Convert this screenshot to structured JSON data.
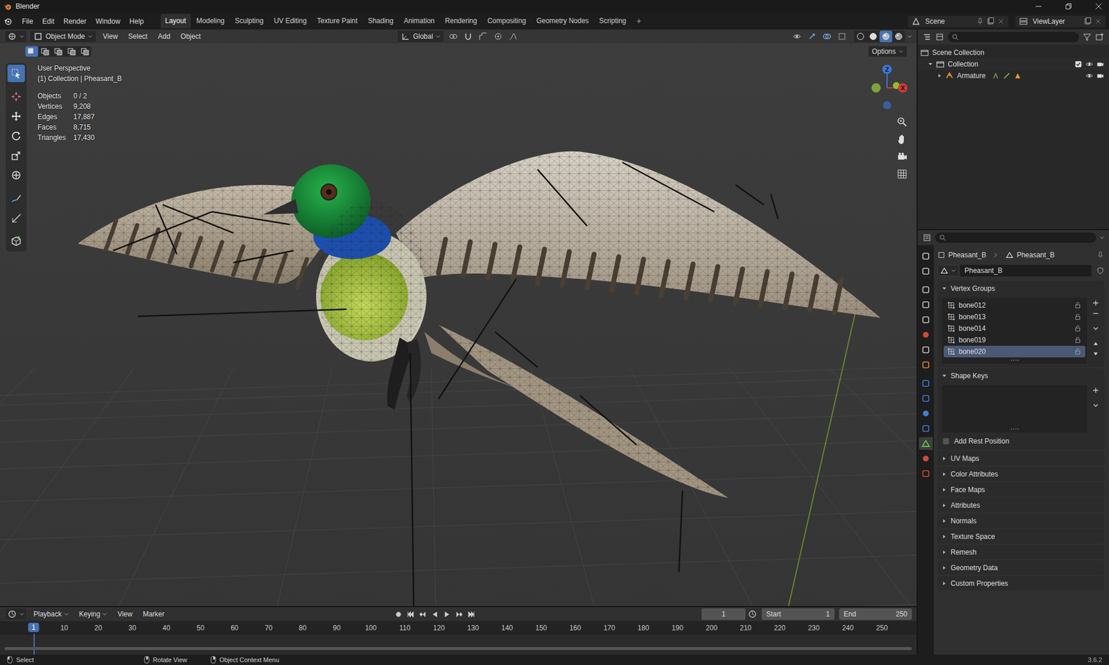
{
  "window": {
    "title": "Blender"
  },
  "menus": [
    "File",
    "Edit",
    "Render",
    "Window",
    "Help"
  ],
  "workspaces": [
    {
      "label": "Layout",
      "selected": true
    },
    {
      "label": "Modeling",
      "selected": false
    },
    {
      "label": "Sculpting",
      "selected": false
    },
    {
      "label": "UV Editing",
      "selected": false
    },
    {
      "label": "Texture Paint",
      "selected": false
    },
    {
      "label": "Shading",
      "selected": false
    },
    {
      "label": "Animation",
      "selected": false
    },
    {
      "label": "Rendering",
      "selected": false
    },
    {
      "label": "Compositing",
      "selected": false
    },
    {
      "label": "Geometry Nodes",
      "selected": false
    },
    {
      "label": "Scripting",
      "selected": false
    }
  ],
  "add_workspace": "+",
  "scene": "Scene",
  "view_layer": "ViewLayer",
  "viewport": {
    "mode": "Object Mode",
    "menus": [
      "View",
      "Select",
      "Add",
      "Object"
    ],
    "orientation": "Global",
    "options": "Options",
    "select_modes": [
      {
        "selected": true
      },
      {
        "selected": false
      },
      {
        "selected": false
      },
      {
        "selected": false
      },
      {
        "selected": false
      }
    ],
    "shading_modes": [
      {
        "selected": false
      },
      {
        "selected": false
      },
      {
        "selected": true
      },
      {
        "selected": false
      }
    ],
    "tools": [
      {
        "kind": "select",
        "selected": true
      },
      {
        "kind": "cursor",
        "selected": false
      },
      {
        "kind": "move",
        "selected": false
      },
      {
        "kind": "rotate",
        "selected": false
      },
      {
        "kind": "scale",
        "selected": false
      },
      {
        "kind": "transform",
        "selected": false
      },
      {
        "kind": "annotate",
        "selected": false
      },
      {
        "kind": "measure",
        "selected": false
      },
      {
        "kind": "add",
        "selected": false
      }
    ],
    "overlay": {
      "title": "User Perspective",
      "subtitle": "(1) Collection | Pheasant_B",
      "stats": [
        {
          "label": "Objects",
          "value": "0 / 2"
        },
        {
          "label": "Vertices",
          "value": "9,208"
        },
        {
          "label": "Edges",
          "value": "17,887"
        },
        {
          "label": "Faces",
          "value": "8,715"
        },
        {
          "label": "Triangles",
          "value": "17,430"
        }
      ]
    },
    "gizmo": {
      "z": "Z",
      "x": "X"
    }
  },
  "outliner": {
    "rows": [
      {
        "label": "Scene Collection",
        "kind": "scene",
        "expanded": true,
        "checked": false,
        "visible": true
      },
      {
        "label": "Collection",
        "kind": "collection",
        "expanded": true,
        "checked": true,
        "visible": true
      },
      {
        "label": "Armature",
        "kind": "armature",
        "expanded": false,
        "checked": false,
        "visible": true
      }
    ]
  },
  "properties": {
    "tabs": [
      {
        "kind": "tool",
        "selected": false
      },
      {
        "kind": "render",
        "selected": false
      },
      {
        "kind": "output",
        "selected": false
      },
      {
        "kind": "view-layer",
        "selected": false
      },
      {
        "kind": "scene",
        "selected": false
      },
      {
        "kind": "world",
        "selected": false
      },
      {
        "kind": "collection",
        "selected": false
      },
      {
        "kind": "object",
        "selected": false
      },
      {
        "kind": "modifiers",
        "selected": false
      },
      {
        "kind": "particles",
        "selected": false
      },
      {
        "kind": "physics",
        "selected": false
      },
      {
        "kind": "constraints",
        "selected": false
      },
      {
        "kind": "data",
        "selected": true
      },
      {
        "kind": "material",
        "selected": false
      },
      {
        "kind": "texture",
        "selected": false
      }
    ],
    "breadcrumb": [
      "Pheasant_B",
      "Pheasant_B"
    ],
    "mesh_name": "Pheasant_B",
    "vertex_groups": {
      "title": "Vertex Groups",
      "expanded": true,
      "items": [
        {
          "name": "bone012",
          "selected": false,
          "locked": false
        },
        {
          "name": "bone013",
          "selected": false,
          "locked": false
        },
        {
          "name": "bone014",
          "selected": false,
          "locked": false
        },
        {
          "name": "bone019",
          "selected": false,
          "locked": false
        },
        {
          "name": "bone020",
          "selected": true,
          "locked": false
        }
      ]
    },
    "shape_keys": {
      "title": "Shape Keys",
      "expanded": true
    },
    "rest_position": {
      "label": "Add Rest Position",
      "checked": false
    },
    "collapsed_panels": [
      {
        "title": "UV Maps",
        "expanded": false
      },
      {
        "title": "Color Attributes",
        "expanded": false
      },
      {
        "title": "Face Maps",
        "expanded": false
      },
      {
        "title": "Attributes",
        "expanded": false
      },
      {
        "title": "Normals",
        "expanded": false
      },
      {
        "title": "Texture Space",
        "expanded": false
      },
      {
        "title": "Remesh",
        "expanded": false
      },
      {
        "title": "Geometry Data",
        "expanded": false
      },
      {
        "title": "Custom Properties",
        "expanded": false
      }
    ]
  },
  "timeline": {
    "menus": [
      "Playback",
      "Keying",
      "View",
      "Marker"
    ],
    "current_frame": "1",
    "start": {
      "label": "Start",
      "value": "1"
    },
    "end": {
      "label": "End",
      "value": "250"
    },
    "playhead": "1",
    "ticks": [
      "10",
      "20",
      "30",
      "40",
      "50",
      "60",
      "70",
      "80",
      "90",
      "100",
      "110",
      "120",
      "130",
      "140",
      "150",
      "160",
      "170",
      "180",
      "190",
      "200",
      "210",
      "220",
      "230",
      "240",
      "250"
    ]
  },
  "status_bar": {
    "items": [
      "Select",
      "Rotate View",
      "Object Context Menu"
    ],
    "version": "3.6.2"
  }
}
